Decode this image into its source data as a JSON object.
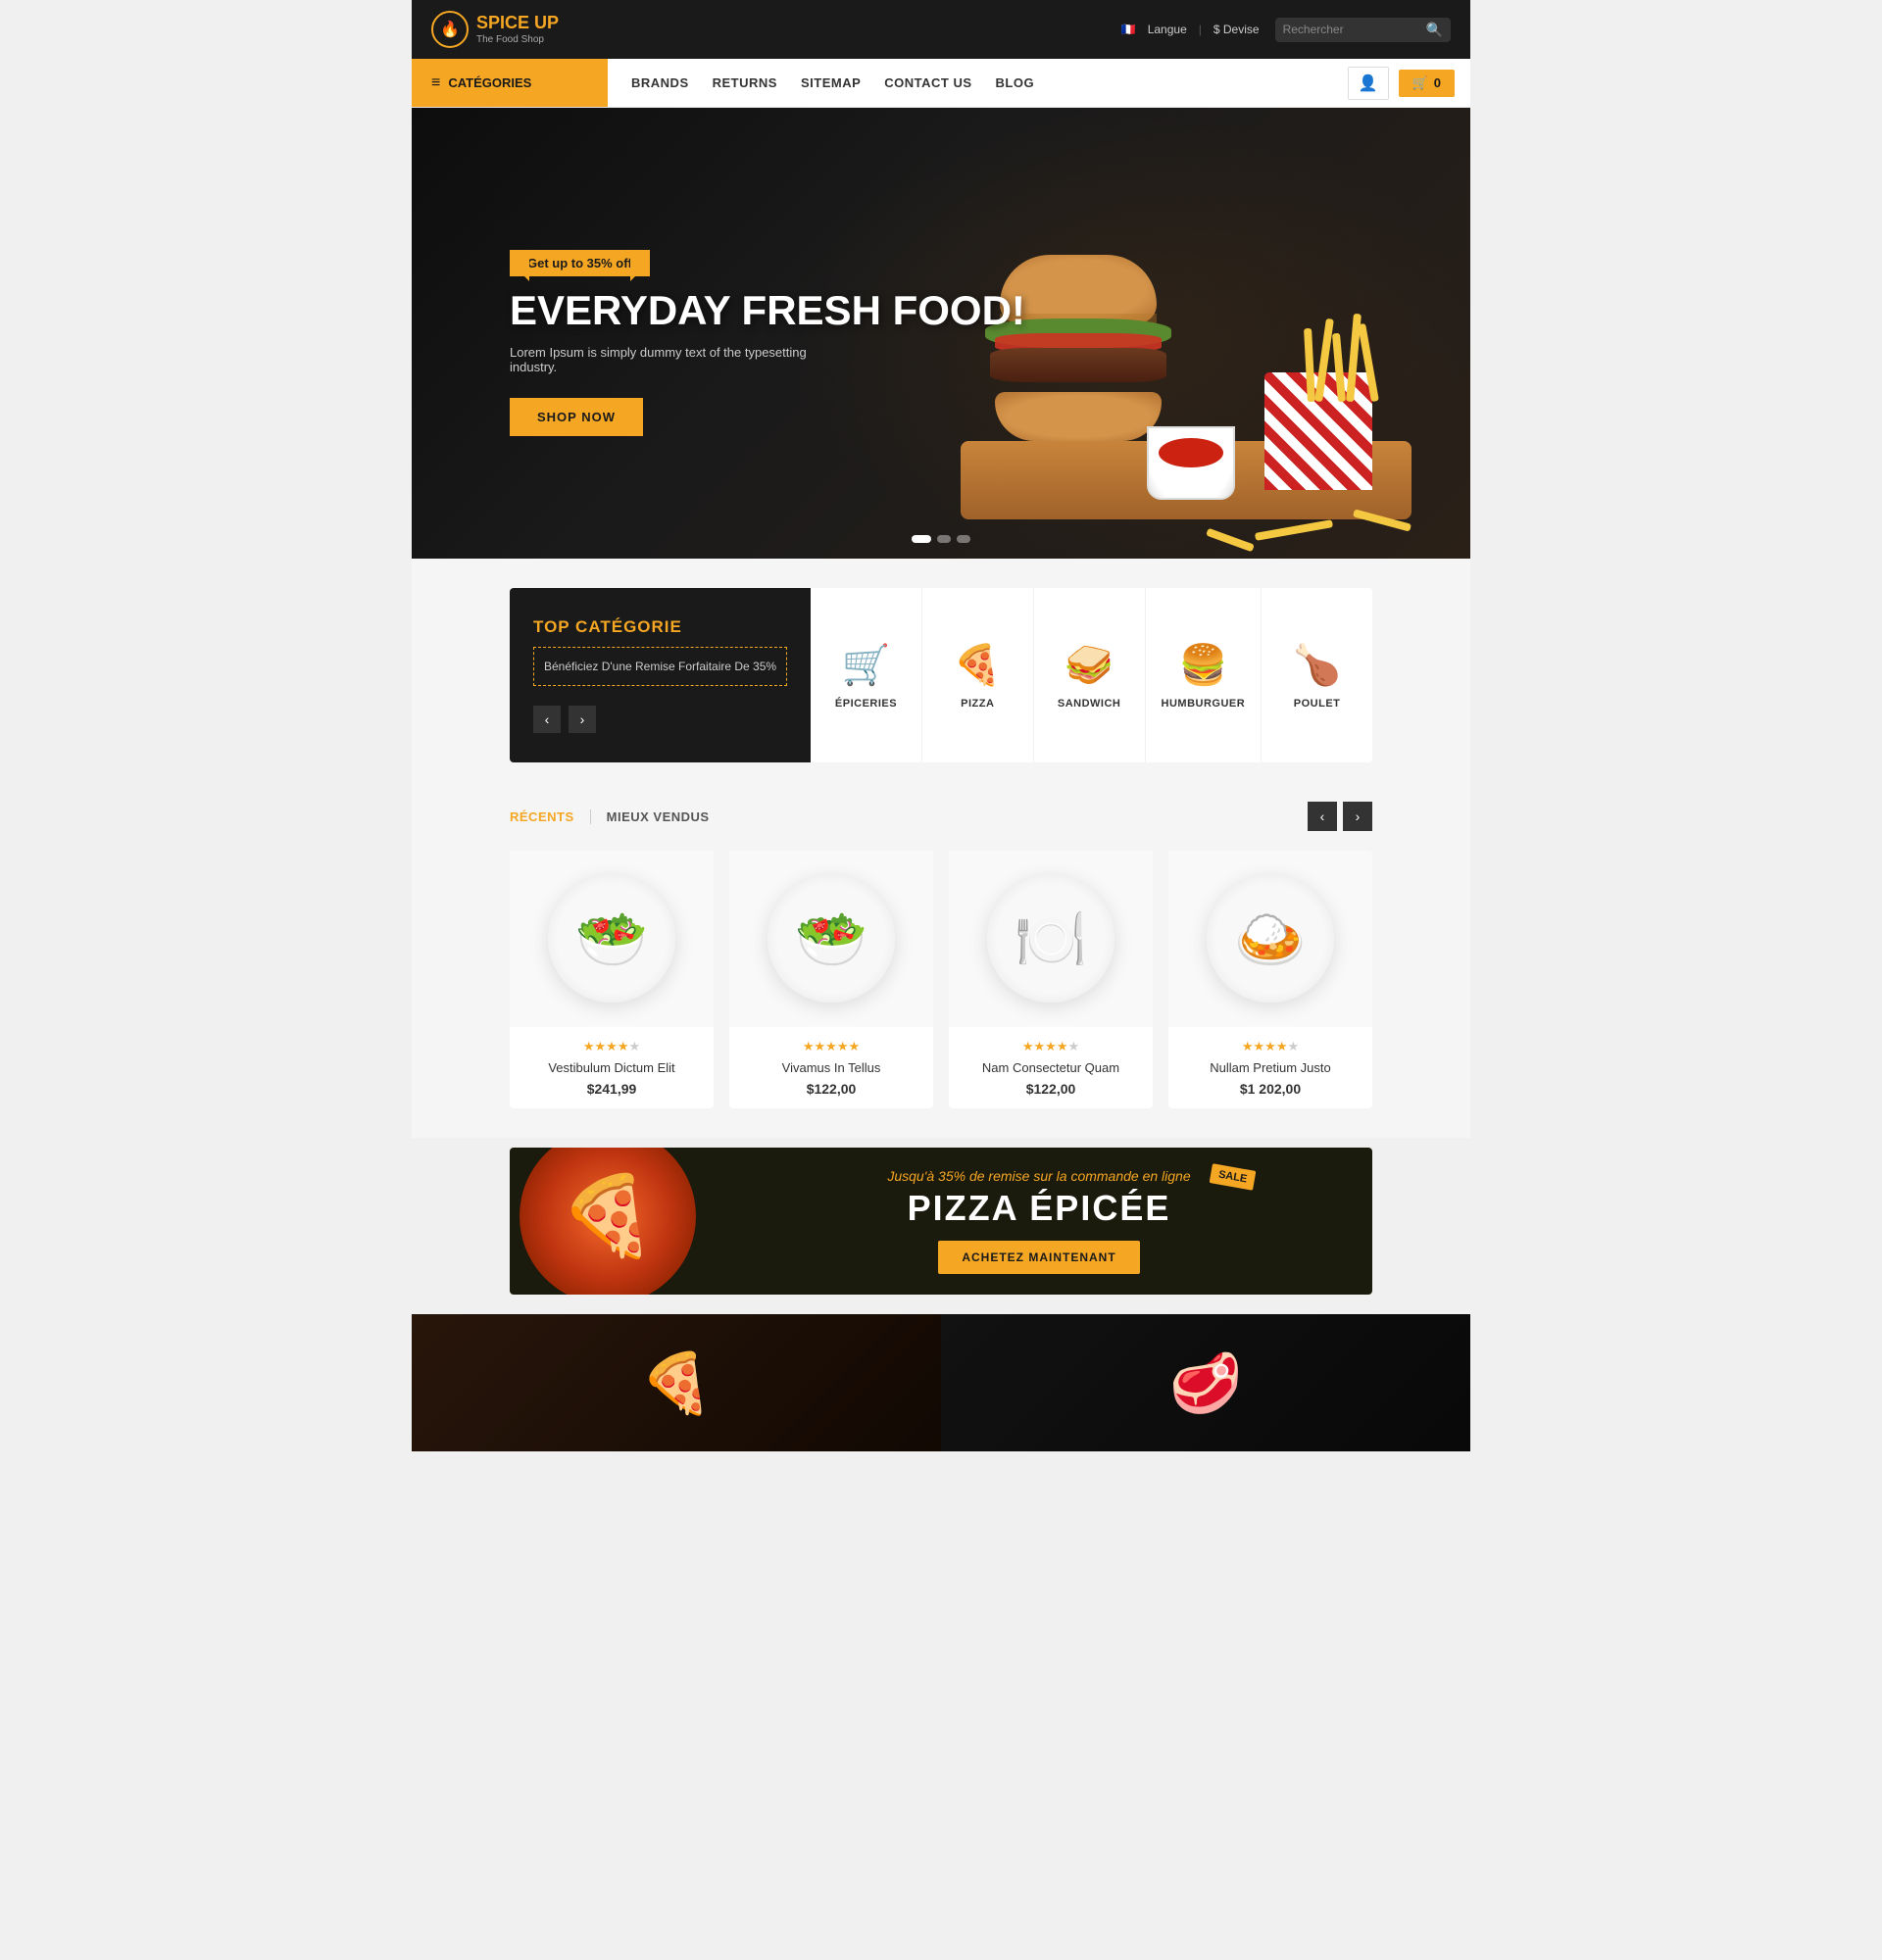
{
  "header": {
    "logo": {
      "icon": "🔥",
      "brand_spice": "SPICE",
      "brand_up": " UP",
      "tagline": "The Food Shop"
    },
    "language": "Langue",
    "currency": "$ Devise",
    "search_placeholder": "Rechercher",
    "cart_count": "0"
  },
  "nav": {
    "categories_label": "CATÉGORIES",
    "links": [
      {
        "label": "BRANDS"
      },
      {
        "label": "RETURNS"
      },
      {
        "label": "SITEMAP"
      },
      {
        "label": "CONTACT US"
      },
      {
        "label": "BLOG"
      }
    ]
  },
  "hero": {
    "promo_badge": "Get up to 35% off",
    "title": "EVERYDAY FRESH FOOD!",
    "subtitle": "Lorem Ipsum is simply dummy text of the typesetting industry.",
    "cta_label": "SHOP NOW",
    "dots": [
      true,
      false,
      false
    ]
  },
  "top_category": {
    "label": "TOP CATÉGORIE",
    "description": "Bénéficiez D'une Remise Forfaitaire De 35%",
    "items": [
      {
        "name": "ÉPICERIES",
        "emoji": "🛒"
      },
      {
        "name": "PIZZA",
        "emoji": "🍕"
      },
      {
        "name": "SANDWICH",
        "emoji": "🥪"
      },
      {
        "name": "HUMBURGUER",
        "emoji": "🍔"
      },
      {
        "name": "POULET",
        "emoji": "🍗"
      }
    ]
  },
  "products": {
    "tab_recent": "RÉCENTS",
    "tab_bestseller": "MIEUX VENDUS",
    "items": [
      {
        "name": "Vestibulum Dictum Elit",
        "price": "$241,99",
        "stars": 4,
        "half_star": true,
        "emoji": "🥗"
      },
      {
        "name": "Vivamus In Tellus",
        "price": "$122,00",
        "stars": 5,
        "half_star": false,
        "emoji": "🥗"
      },
      {
        "name": "Nam Consectetur Quam",
        "price": "$122,00",
        "stars": 4,
        "half_star": false,
        "emoji": "🍽️"
      },
      {
        "name": "Nullam Pretium Justo",
        "price": "$1 202,00",
        "stars": 4,
        "half_star": true,
        "emoji": "🍛"
      }
    ]
  },
  "pizza_banner": {
    "promo_text": "Jusqu'à 35% de remise sur la commande en ligne",
    "title": "PIZZA ÉPICÉE",
    "cta_label": "ACHETEZ MAINTENANT",
    "sale_label": "SALE"
  },
  "icons": {
    "hamburger": "≡",
    "search": "🔍",
    "user": "👤",
    "cart": "🛒",
    "arrow_left": "‹",
    "arrow_right": "›",
    "flag": "🇫🇷"
  }
}
